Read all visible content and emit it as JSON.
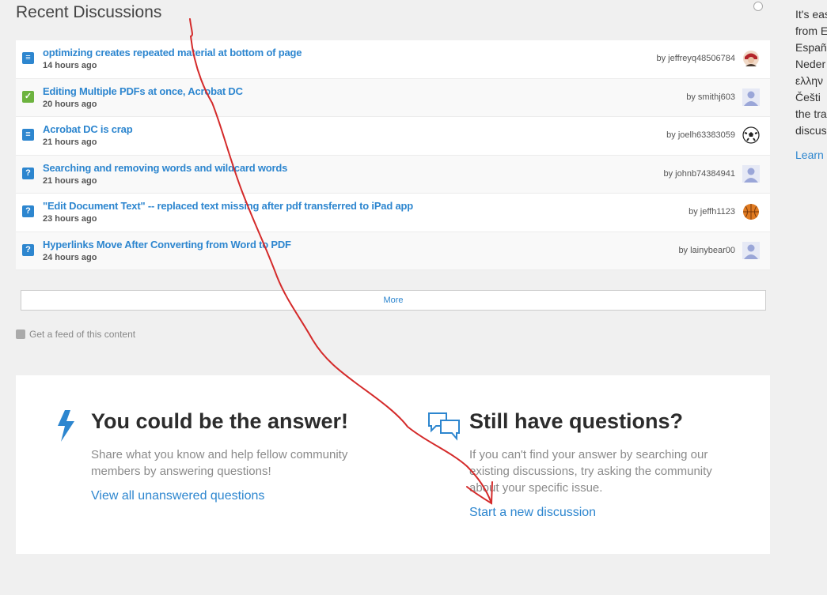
{
  "section_title": "Recent Discussions",
  "discussions": [
    {
      "title": "optimizing creates repeated material at bottom of page",
      "time": "14 hours ago",
      "by": "by jeffreyq48506784",
      "icon": "discussion-icon",
      "icon_color": "#2d86cf",
      "avatar": "user-photo-avatar"
    },
    {
      "title": "Editing Multiple PDFs at once, Acrobat DC",
      "time": "20 hours ago",
      "by": "by smithj603",
      "icon": "answered-check-icon",
      "icon_color": "#6db33f",
      "avatar": "default-avatar"
    },
    {
      "title": "Acrobat DC is crap",
      "time": "21 hours ago",
      "by": "by joelh63383059",
      "icon": "discussion-icon",
      "icon_color": "#2d86cf",
      "avatar": "soccer-ball-avatar"
    },
    {
      "title": "Searching and removing words and wildcard words",
      "time": "21 hours ago",
      "by": "by johnb74384941",
      "icon": "question-icon",
      "icon_color": "#2d86cf",
      "avatar": "default-avatar"
    },
    {
      "title": "\"Edit Document Text\" -- replaced text missing after pdf transferred to iPad app",
      "time": "23 hours ago",
      "by": "by jeffh1123",
      "icon": "question-icon",
      "icon_color": "#2d86cf",
      "avatar": "basketball-avatar"
    },
    {
      "title": "Hyperlinks Move After Converting from Word to PDF",
      "time": "24 hours ago",
      "by": "by lainybear00",
      "icon": "question-icon",
      "icon_color": "#2d86cf",
      "avatar": "default-avatar"
    }
  ],
  "more_label": "More",
  "feed_label": "Get a feed of this content",
  "answer_panel": {
    "title": "You could be the answer!",
    "text": "Share what you know and help fellow community members by answering questions!",
    "link": "View all unanswered questions"
  },
  "questions_panel": {
    "title": "Still have questions?",
    "text": "If you can't find your answer by searching our existing discussions, try asking the community about your specific issue.",
    "link": "Start a new discussion"
  },
  "sidebar": {
    "lines": [
      "It's eas",
      "from E",
      "Españ",
      "Neder",
      "ελλην",
      "Češti",
      "the tra",
      "discus"
    ],
    "learn": "Learn"
  },
  "colors": {
    "link": "#2d86cf",
    "annotation": "#d42a2a",
    "accent_green": "#6db33f"
  }
}
